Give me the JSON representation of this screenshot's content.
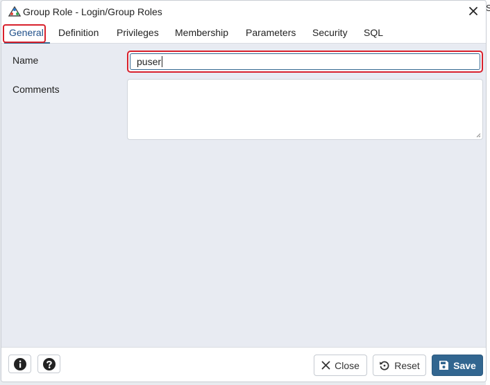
{
  "window": {
    "title": "Group Role - Login/Group Roles",
    "app_logo_icon": "pgadmin-elephant-icon",
    "close_icon": "close-icon",
    "edge_glyph": "S"
  },
  "tabs": [
    {
      "label": "General",
      "active": true
    },
    {
      "label": "Definition",
      "active": false
    },
    {
      "label": "Privileges",
      "active": false
    },
    {
      "label": "Membership",
      "active": false
    },
    {
      "label": "Parameters",
      "active": false
    },
    {
      "label": "Security",
      "active": false
    },
    {
      "label": "SQL",
      "active": false
    }
  ],
  "form": {
    "name_label": "Name",
    "name_value": "puser",
    "comments_label": "Comments",
    "comments_value": ""
  },
  "footer": {
    "info_icon": "info-icon",
    "help_icon": "help-icon",
    "close_label": "Close",
    "reset_label": "Reset",
    "save_label": "Save"
  },
  "colors": {
    "accent": "#326690",
    "highlight": "#d8202b",
    "content_bg": "#e8ebf2"
  }
}
